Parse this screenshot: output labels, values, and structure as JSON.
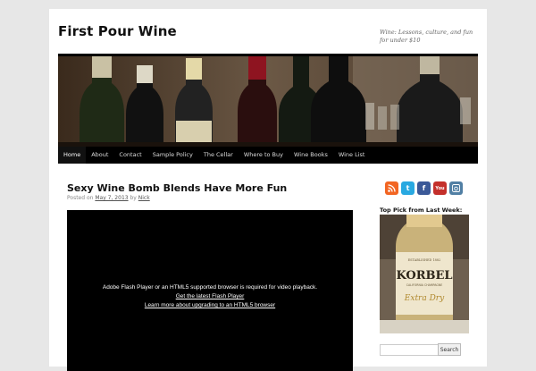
{
  "site": {
    "title": "First Pour Wine",
    "description": "Wine: Lessons, culture, and fun for under $10"
  },
  "nav": {
    "items": [
      "Home",
      "About",
      "Contact",
      "Sample Policy",
      "The Cellar",
      "Where to Buy",
      "Wine Books",
      "Wine List"
    ],
    "active": "Home"
  },
  "post": {
    "title": "Sexy Wine Bomb Blends Have More Fun",
    "posted_on_label": "Posted on",
    "date": "May 7, 2013",
    "by_label": "by",
    "author": "Nick"
  },
  "video": {
    "message": "Adobe Flash Player or an HTML5 supported browser is required for video playback.",
    "link1": "Get the latest Flash Player",
    "link2": "Learn more about upgrading to an HTML5 browser"
  },
  "sidebar": {
    "social_icons": [
      "rss-icon",
      "twitter-icon",
      "facebook-icon",
      "youtube-icon",
      "instagram-icon"
    ],
    "widget_title": "Top Pick from Last Week:",
    "pick_brand": "KORBEL",
    "pick_sub": "Extra Dry",
    "pick_region": "CALIFORNIA CHAMPAGNE",
    "pick_estab": "ESTABLISHED 1882",
    "search_placeholder": "",
    "search_button": "Search"
  },
  "colors": {
    "page_bg": "#e7e7e7",
    "nav_bg": "#000000",
    "rss": "#f26522",
    "twitter": "#29a9e1",
    "facebook": "#3b5998",
    "youtube": "#c4302b",
    "instagram": "#517fa4"
  }
}
